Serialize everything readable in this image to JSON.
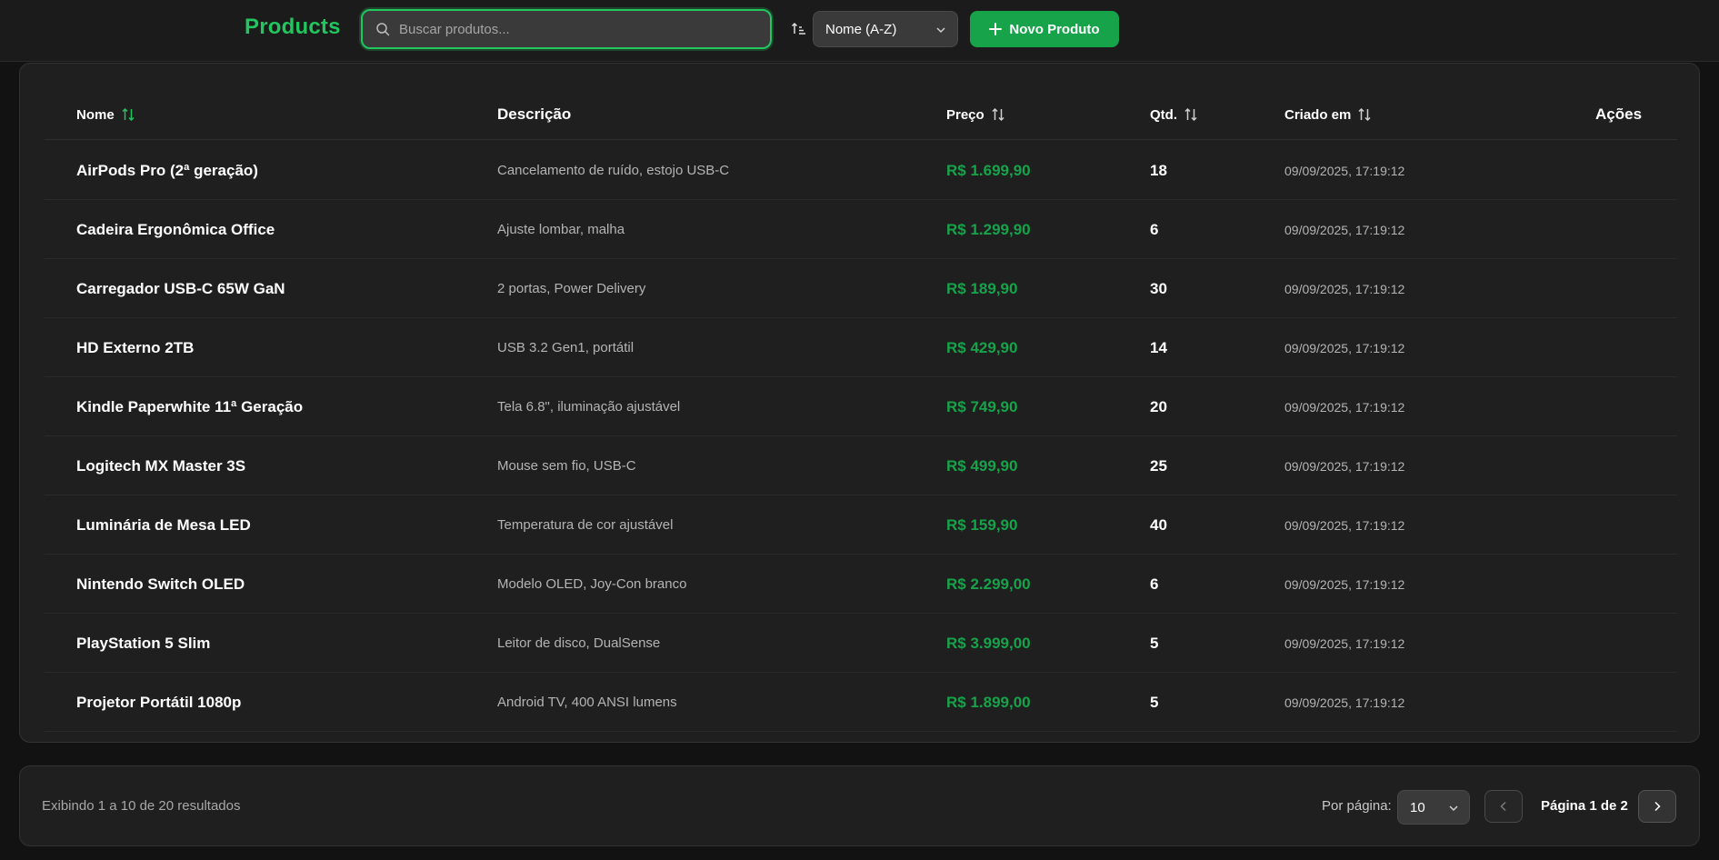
{
  "header": {
    "title": "Products",
    "search_placeholder": "Buscar produtos...",
    "search_value": "",
    "sort_selected": "Nome (A-Z)",
    "new_button_label": "Novo Produto"
  },
  "colors": {
    "accent": "#22c55e",
    "price": "#16a34a",
    "background": "#121212",
    "card": "#1f1f1f"
  },
  "table": {
    "columns": {
      "name": "Nome",
      "description": "Descrição",
      "price": "Preço",
      "qty": "Qtd.",
      "created": "Criado em",
      "actions": "Ações"
    },
    "rows": [
      {
        "name": "AirPods Pro (2ª geração)",
        "description": "Cancelamento de ruído, estojo USB-C",
        "price": "R$ 1.699,90",
        "qty": "18",
        "created": "09/09/2025, 17:19:12"
      },
      {
        "name": "Cadeira Ergonômica Office",
        "description": "Ajuste lombar, malha",
        "price": "R$ 1.299,90",
        "qty": "6",
        "created": "09/09/2025, 17:19:12"
      },
      {
        "name": "Carregador USB-C 65W GaN",
        "description": "2 portas, Power Delivery",
        "price": "R$ 189,90",
        "qty": "30",
        "created": "09/09/2025, 17:19:12"
      },
      {
        "name": "HD Externo 2TB",
        "description": "USB 3.2 Gen1, portátil",
        "price": "R$ 429,90",
        "qty": "14",
        "created": "09/09/2025, 17:19:12"
      },
      {
        "name": "Kindle Paperwhite 11ª Geração",
        "description": "Tela 6.8\", iluminação ajustável",
        "price": "R$ 749,90",
        "qty": "20",
        "created": "09/09/2025, 17:19:12"
      },
      {
        "name": "Logitech MX Master 3S",
        "description": "Mouse sem fio, USB-C",
        "price": "R$ 499,90",
        "qty": "25",
        "created": "09/09/2025, 17:19:12"
      },
      {
        "name": "Luminária de Mesa LED",
        "description": "Temperatura de cor ajustável",
        "price": "R$ 159,90",
        "qty": "40",
        "created": "09/09/2025, 17:19:12"
      },
      {
        "name": "Nintendo Switch OLED",
        "description": "Modelo OLED, Joy-Con branco",
        "price": "R$ 2.299,00",
        "qty": "6",
        "created": "09/09/2025, 17:19:12"
      },
      {
        "name": "PlayStation 5 Slim",
        "description": "Leitor de disco, DualSense",
        "price": "R$ 3.999,00",
        "qty": "5",
        "created": "09/09/2025, 17:19:12"
      },
      {
        "name": "Projetor Portátil 1080p",
        "description": "Android TV, 400 ANSI lumens",
        "price": "R$ 1.899,00",
        "qty": "5",
        "created": "09/09/2025, 17:19:12"
      }
    ]
  },
  "footer": {
    "results_text": "Exibindo 1 a 10 de 20 resultados",
    "per_page_label": "Por página:",
    "per_page_value": "10",
    "page_indicator": "Página 1 de 2"
  }
}
